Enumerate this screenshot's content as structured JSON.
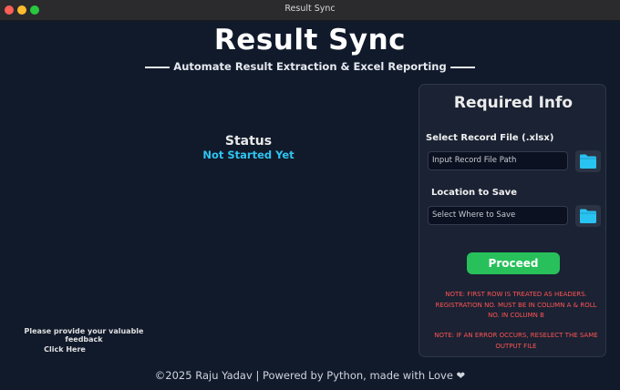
{
  "window": {
    "title": "Result Sync"
  },
  "header": {
    "title": "Result Sync",
    "subtitle": "Automate Result Extraction & Excel Reporting"
  },
  "status": {
    "label": "Status",
    "value": "Not Started Yet"
  },
  "feedback": {
    "text": "Please provide your valuable feedback",
    "link": "Click Here"
  },
  "footer": "©2025 Raju Yadav | Powered by Python, made with Love ❤",
  "panel": {
    "title": "Required Info",
    "record_label": "Select Record File (.xlsx)",
    "record_placeholder": "Input Record File Path",
    "save_label": "Location to Save",
    "save_placeholder": "Select Where to Save",
    "proceed_label": "Proceed",
    "note1": "NOTE: FIRST ROW IS TREATED AS HEADERS. REGISTRATION NO. MUST BE IN COLUMN A & ROLL NO. IN COLUMN B",
    "note2": "NOTE: IF AN ERROR OCCURS, RESELECT THE SAME OUTPUT FILE"
  },
  "icons": {
    "browse": "folder-icon"
  },
  "colors": {
    "background": "#111a2b",
    "accent": "#2ec4f0",
    "proceed": "#27c05a",
    "note": "#ff5454",
    "folder": "#29c3f2"
  }
}
